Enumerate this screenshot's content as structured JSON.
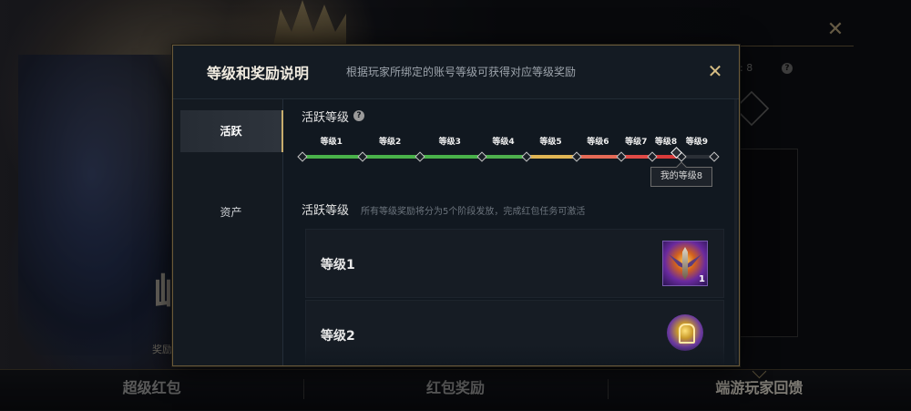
{
  "background": {
    "big_char": "屾",
    "small_text": "奖励",
    "right_label": ": 8",
    "help_glyph": "?",
    "close_glyph": "✕"
  },
  "bottom_nav": {
    "tabs": [
      {
        "label": "超级红包",
        "active": false
      },
      {
        "label": "红包奖励",
        "active": false
      },
      {
        "label": "端游玩家回馈",
        "active": true
      }
    ]
  },
  "modal": {
    "title": "等级和奖励说明",
    "subtitle": "根据玩家所绑定的账号等级可获得对应等级奖励",
    "close_glyph": "✕",
    "sidebar": [
      {
        "label": "活跃",
        "active": true
      },
      {
        "label": "资产",
        "active": false
      }
    ],
    "activity_section": {
      "title": "活跃等级",
      "help_glyph": "?",
      "levels": [
        "等级1",
        "等级2",
        "等级3",
        "等级4",
        "等级5",
        "等级6",
        "等级7",
        "等级8",
        "等级9"
      ],
      "level_colors": [
        "#49b24a",
        "#49b24a",
        "#49b24a",
        "#4eb04d",
        "#e0b554",
        "#e56a56",
        "#e14a46",
        "#d83a3a",
        "#2a2f36"
      ],
      "my_level_fraction": 0.91,
      "tooltip": "我的等级8"
    },
    "rewards_section": {
      "title": "活跃等级",
      "note": "所有等级奖励将分为5个阶段发放，完成红包任务可激活",
      "rows": [
        {
          "label": "等级1",
          "icon": "sword-emblem-icon",
          "quantity": "1"
        },
        {
          "label": "等级2",
          "icon": "hooded-mage-icon",
          "quantity": ""
        }
      ]
    }
  }
}
